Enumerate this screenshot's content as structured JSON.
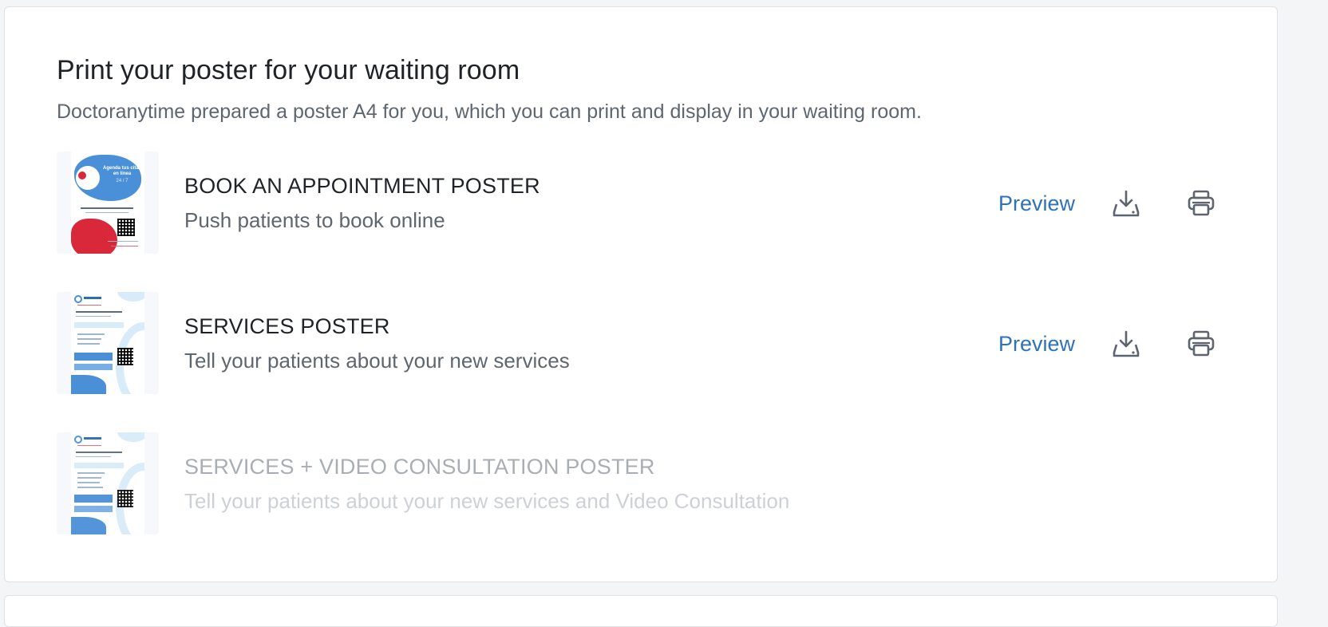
{
  "section": {
    "title": "Print your poster for your waiting room",
    "subtitle": "Doctoranytime prepared a poster A4 for you, which you can print and display in your waiting room."
  },
  "posters": [
    {
      "title": "BOOK AN APPOINTMENT POSTER",
      "description": "Push patients to book online",
      "preview_label": "Preview",
      "download_icon": "download-tray-icon",
      "print_icon": "printer-icon",
      "enabled": true,
      "thumb_text": "Agenda tus citas en línea",
      "thumb_sub": "24 / 7"
    },
    {
      "title": "SERVICES POSTER",
      "description": "Tell your patients about your new services",
      "preview_label": "Preview",
      "download_icon": "download-tray-icon",
      "print_icon": "printer-icon",
      "enabled": true
    },
    {
      "title": "SERVICES + VIDEO CONSULTATION POSTER",
      "description": "Tell your patients about your new services and Video Consultation",
      "enabled": false
    }
  ],
  "colors": {
    "link": "#2f72b7",
    "title": "#1f2328",
    "muted": "#5e6670",
    "disabled_title": "#a9aeb4",
    "disabled_text": "#cdd1d6",
    "poster_blue": "#4a90d9",
    "poster_red": "#d9283a"
  }
}
